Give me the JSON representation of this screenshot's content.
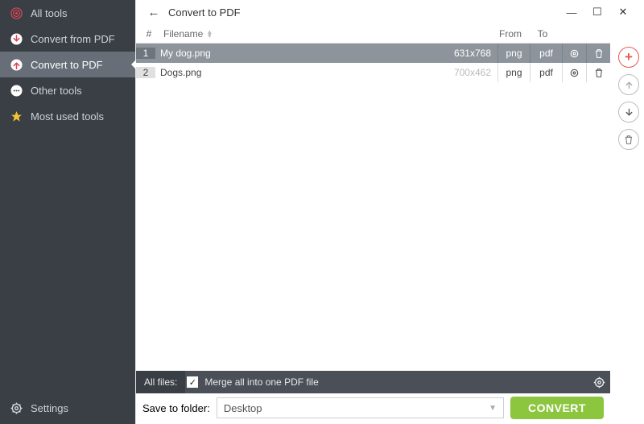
{
  "sidebar": {
    "items": [
      {
        "label": "All tools"
      },
      {
        "label": "Convert from PDF"
      },
      {
        "label": "Convert to PDF"
      },
      {
        "label": "Other tools"
      },
      {
        "label": "Most used tools"
      }
    ],
    "settings": "Settings"
  },
  "titlebar": {
    "title": "Convert to PDF"
  },
  "table": {
    "headers": {
      "num": "#",
      "filename": "Filename",
      "from": "From",
      "to": "To"
    },
    "rows": [
      {
        "n": "1",
        "name": "My dog.png",
        "dim": "631x768",
        "from": "png",
        "to": "pdf",
        "selected": true
      },
      {
        "n": "2",
        "name": "Dogs.png",
        "dim": "700x462",
        "from": "png",
        "to": "pdf",
        "selected": false
      }
    ]
  },
  "footer": {
    "allfiles": "All files:",
    "merge": "Merge all into one PDF file"
  },
  "bottom": {
    "save_label": "Save to folder:",
    "folder": "Desktop",
    "convert": "CONVERT"
  }
}
